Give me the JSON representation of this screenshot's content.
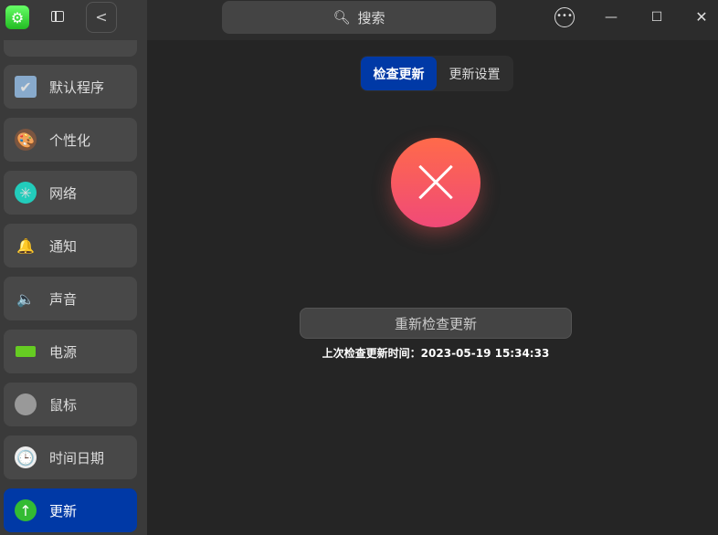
{
  "sidebar": {
    "items": [
      {
        "label": "默认程序",
        "icon": "default-apps-icon"
      },
      {
        "label": "个性化",
        "icon": "personalization-icon"
      },
      {
        "label": "网络",
        "icon": "network-icon"
      },
      {
        "label": "通知",
        "icon": "bell-icon"
      },
      {
        "label": "声音",
        "icon": "speaker-icon"
      },
      {
        "label": "电源",
        "icon": "battery-icon"
      },
      {
        "label": "鼠标",
        "icon": "mouse-icon"
      },
      {
        "label": "时间日期",
        "icon": "clock-icon"
      },
      {
        "label": "更新",
        "icon": "update-icon"
      }
    ]
  },
  "search": {
    "label": "搜索"
  },
  "tabs": [
    "检查更新",
    "更新设置"
  ],
  "main": {
    "recheck_label": "重新检查更新",
    "last_check": "上次检查更新时间：2023-05-19 15:34:33"
  },
  "colors": {
    "accent": "#0039a6",
    "error": "#f55a5a"
  }
}
